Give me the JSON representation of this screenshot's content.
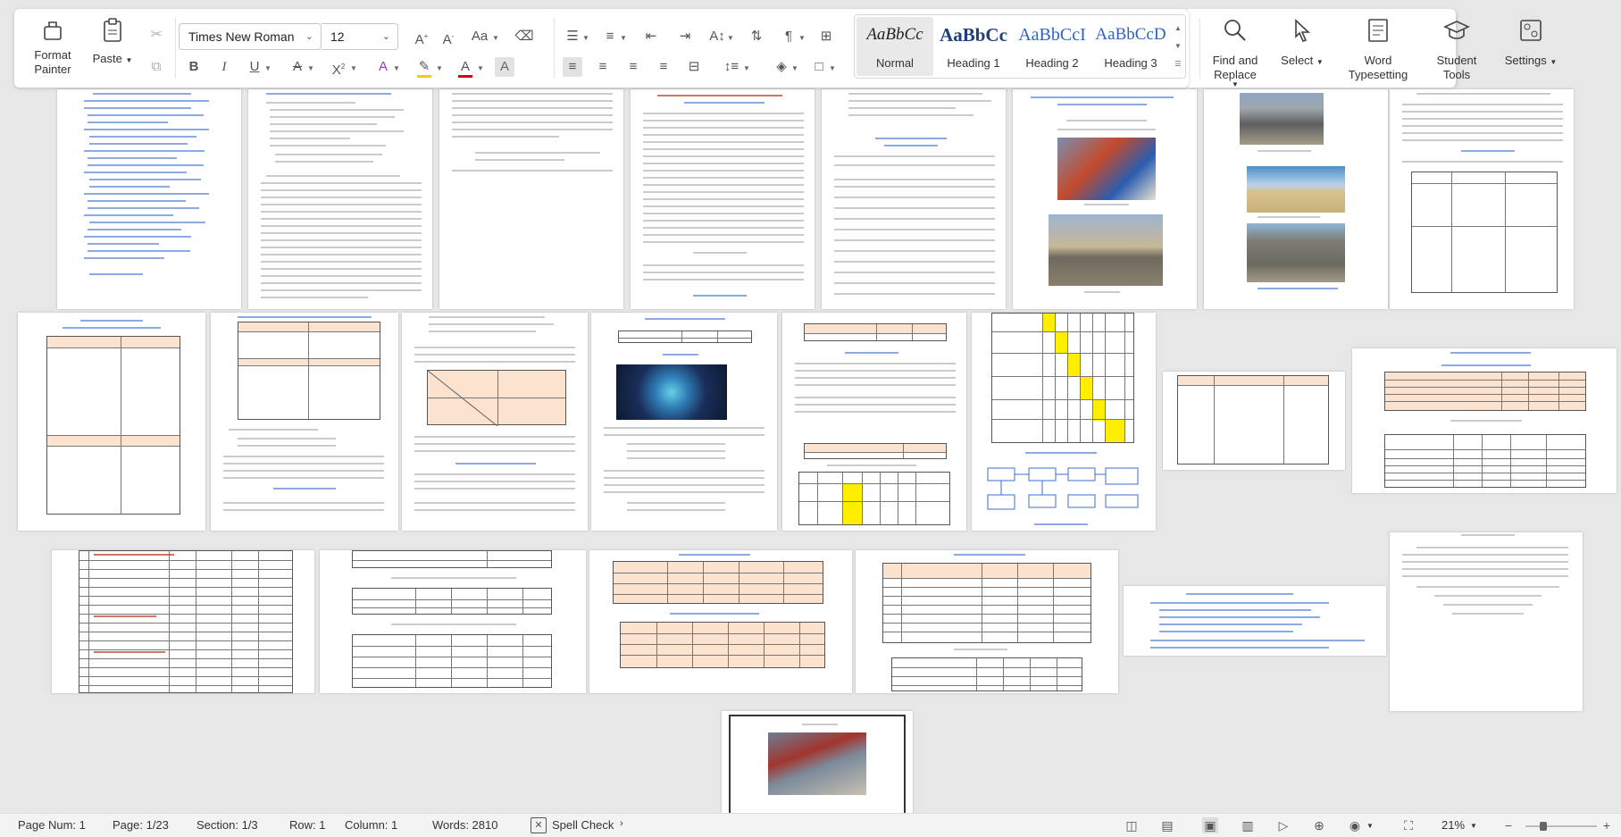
{
  "ribbon": {
    "clipboard": {
      "format_painter": "Format Painter",
      "paste": "Paste"
    },
    "font": {
      "family": "Times New Roman",
      "size": "12"
    },
    "styles": [
      {
        "preview": "AaBbCc",
        "name": "Normal"
      },
      {
        "preview": "AaBbCc",
        "name": "Heading 1"
      },
      {
        "preview": "AaBbCcI",
        "name": "Heading 2"
      },
      {
        "preview": "AaBbCcD",
        "name": "Heading 3"
      }
    ],
    "tools": {
      "find_replace": "Find and Replace",
      "select": "Select",
      "word_typesetting": "Word Typesetting",
      "student_tools": "Student Tools",
      "settings": "Settings"
    }
  },
  "status": {
    "page_num": "Page Num: 1",
    "page": "Page: 1/23",
    "section": "Section: 1/3",
    "row": "Row: 1",
    "column": "Column: 1",
    "words": "Words: 2810",
    "spell_check": "Spell Check",
    "zoom": "21%"
  },
  "colors": {
    "accent": "#3f6fcf",
    "table_header": "#fbe3cf",
    "highlight": "#ffee00"
  }
}
